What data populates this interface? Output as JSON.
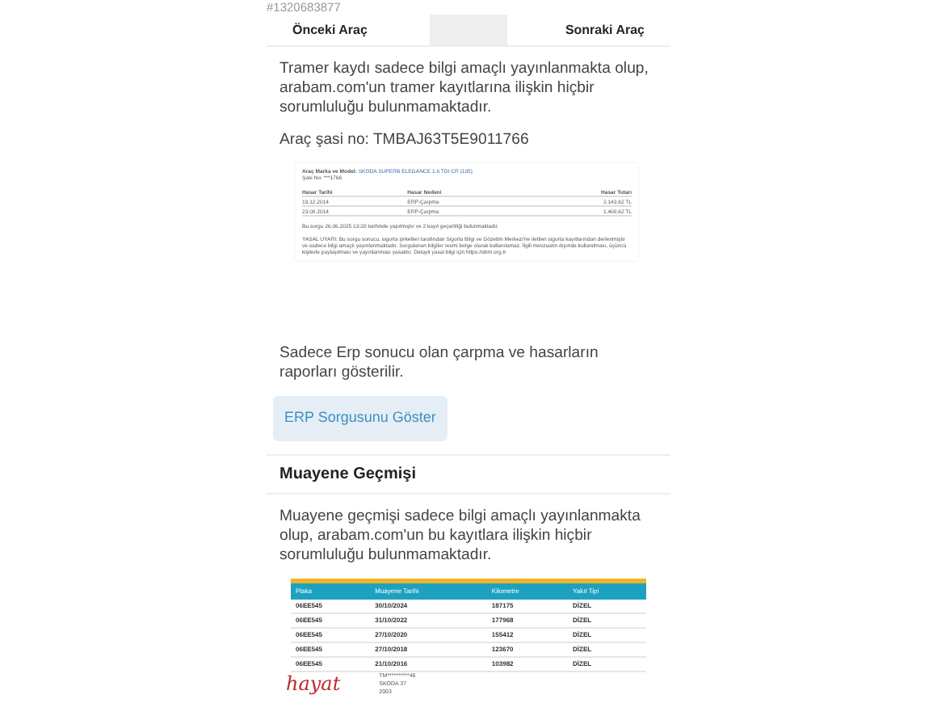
{
  "listing_id": "#1320683877",
  "nav": [
    {
      "label": "Önceki Araç",
      "kind": "prev"
    },
    {
      "label": "Sonraki Araç",
      "kind": "next"
    }
  ],
  "tramer": {
    "notice": "Tramer kaydı sadece bilgi amaçlı yayınlanmakta olup, arabam.com'un tramer kayıtlarına ilişkin hiçbir sorumluluğu bulunmamaktadır.",
    "chassis": "Araç şasi no: TMBAJ63T5E9011766",
    "report": {
      "model_label": "Araç Marka ve Model:",
      "model": "SKODA SUPERB ELEGANCE 1.6 TDI CR (105)",
      "chassis": "Şasi No: ***1766",
      "columns": [
        "Hasar Tarihi",
        "Hasar Nedeni",
        "Hasar Tutarı"
      ],
      "rows": [
        [
          "19.12.2014",
          "ERP-Çarpma",
          "2.143,62 TL"
        ],
        [
          "23.08.2014",
          "ERP-Çarpma",
          "1.408,62 TL"
        ]
      ],
      "footnote": "Bu sorgu 26.06.2025 13:28 tarihinde yapılmıştır ve 2 kayıt geçerliliği bulunmaktadır.",
      "disclaimer": "YASAL UYARI: Bu sorgu sonucu, sigorta şirketleri tarafından Sigorta Bilgi ve Gözetim Merkezi'ne iletilen sigorta kayıtlarından derlenmiştir ve sadece bilgi amaçlı yayınlanmaktadır. Sorgulanan bilgiler resmi belge olarak kullanılamaz. İlgili mevzuatın dışında kullanılması, üçüncü kişilerle paylaşılması ve yayınlanması yasaktır. Detaylı yasal bilgi için https://sbm.org.tr"
    }
  },
  "erp": {
    "note": "Sadece Erp sonucu olan çarpma ve hasarların raporları gösterilir.",
    "button": "ERP Sorgusunu Göster"
  },
  "inspection": {
    "title": "Muayene Geçmişi",
    "notice": "Muayene geçmişi sadece bilgi amaçlı yayınlanmakta olup, arabam.com'un bu kayıtlara ilişkin hiçbir sorumluluğu bulunmamaktadır.",
    "columns": [
      "Plaka",
      "Muayene Tarihi",
      "Kilometre",
      "Yakıt Tipi"
    ],
    "rows": [
      [
        "06EE545",
        "30/10/2024",
        "187175",
        "DİZEL"
      ],
      [
        "06EE545",
        "31/10/2022",
        "177968",
        "DİZEL"
      ],
      [
        "06EE545",
        "27/10/2020",
        "155412",
        "DİZEL"
      ],
      [
        "06EE545",
        "27/10/2018",
        "123670",
        "DİZEL"
      ],
      [
        "06EE545",
        "21/10/2016",
        "103982",
        "DİZEL"
      ]
    ],
    "footer": {
      "logo": "hayat",
      "lines": [
        "TM**********46",
        "SKODA 37",
        "2003"
      ]
    }
  }
}
